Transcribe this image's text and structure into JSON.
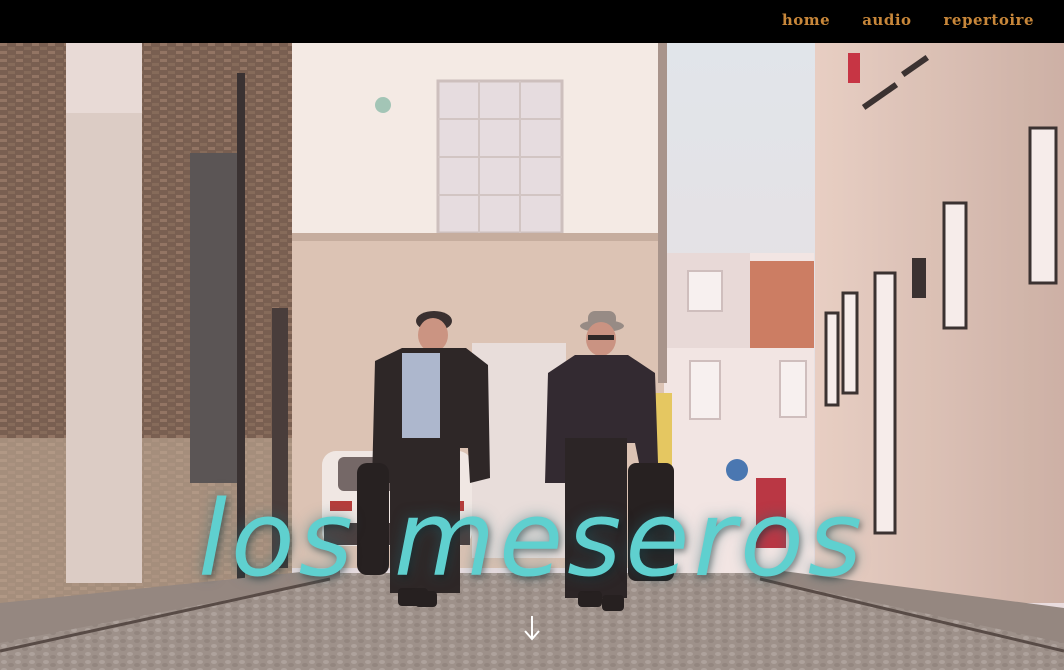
{
  "nav": {
    "items": [
      {
        "label": "home"
      },
      {
        "label": "audio"
      },
      {
        "label": "repertoire"
      }
    ]
  },
  "hero": {
    "title": "los meseros",
    "scroll_icon": "arrow-down-icon"
  },
  "colors": {
    "topbar": "#000000",
    "nav_text": "#c8873a",
    "title": "#5fd0cf"
  }
}
